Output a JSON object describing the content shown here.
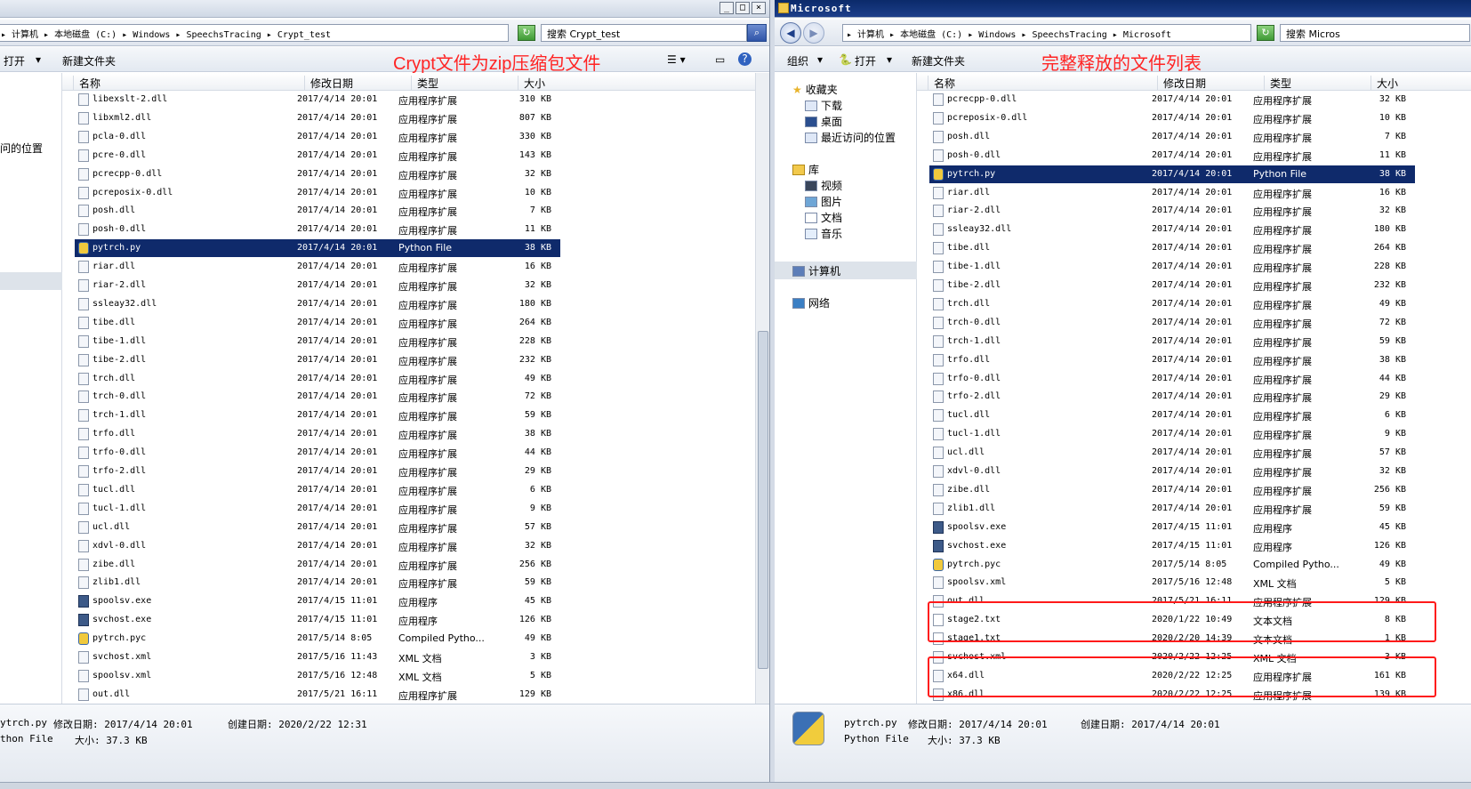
{
  "left": {
    "address": "▸ 计算机 ▸ 本地磁盘 (C:) ▸ Windows ▸ SpeechsTracing ▸ Crypt_test",
    "search_text": "搜索 Crypt_test",
    "toolbar": {
      "open": "打开",
      "new_folder": "新建文件夹"
    },
    "annotation": "Crypt文件为zip压缩包文件",
    "nav_fragment": "问的位置",
    "columns": {
      "name": "名称",
      "date": "修改日期",
      "type": "类型",
      "size": "大小"
    },
    "files": [
      {
        "name": "libexslt-2.dll",
        "date": "2017/4/14 20:01",
        "type": "应用程序扩展",
        "size": "310 KB",
        "icon": "dll"
      },
      {
        "name": "libxml2.dll",
        "date": "2017/4/14 20:01",
        "type": "应用程序扩展",
        "size": "807 KB",
        "icon": "dll"
      },
      {
        "name": "pcla-0.dll",
        "date": "2017/4/14 20:01",
        "type": "应用程序扩展",
        "size": "330 KB",
        "icon": "dll"
      },
      {
        "name": "pcre-0.dll",
        "date": "2017/4/14 20:01",
        "type": "应用程序扩展",
        "size": "143 KB",
        "icon": "dll"
      },
      {
        "name": "pcrecpp-0.dll",
        "date": "2017/4/14 20:01",
        "type": "应用程序扩展",
        "size": "32 KB",
        "icon": "dll"
      },
      {
        "name": "pcreposix-0.dll",
        "date": "2017/4/14 20:01",
        "type": "应用程序扩展",
        "size": "10 KB",
        "icon": "dll"
      },
      {
        "name": "posh.dll",
        "date": "2017/4/14 20:01",
        "type": "应用程序扩展",
        "size": "7 KB",
        "icon": "dll"
      },
      {
        "name": "posh-0.dll",
        "date": "2017/4/14 20:01",
        "type": "应用程序扩展",
        "size": "11 KB",
        "icon": "dll"
      },
      {
        "name": "pytrch.py",
        "date": "2017/4/14 20:01",
        "type": "Python File",
        "size": "38 KB",
        "icon": "py",
        "selected": true
      },
      {
        "name": "riar.dll",
        "date": "2017/4/14 20:01",
        "type": "应用程序扩展",
        "size": "16 KB",
        "icon": "dll"
      },
      {
        "name": "riar-2.dll",
        "date": "2017/4/14 20:01",
        "type": "应用程序扩展",
        "size": "32 KB",
        "icon": "dll"
      },
      {
        "name": "ssleay32.dll",
        "date": "2017/4/14 20:01",
        "type": "应用程序扩展",
        "size": "180 KB",
        "icon": "dll"
      },
      {
        "name": "tibe.dll",
        "date": "2017/4/14 20:01",
        "type": "应用程序扩展",
        "size": "264 KB",
        "icon": "dll"
      },
      {
        "name": "tibe-1.dll",
        "date": "2017/4/14 20:01",
        "type": "应用程序扩展",
        "size": "228 KB",
        "icon": "dll"
      },
      {
        "name": "tibe-2.dll",
        "date": "2017/4/14 20:01",
        "type": "应用程序扩展",
        "size": "232 KB",
        "icon": "dll"
      },
      {
        "name": "trch.dll",
        "date": "2017/4/14 20:01",
        "type": "应用程序扩展",
        "size": "49 KB",
        "icon": "dll"
      },
      {
        "name": "trch-0.dll",
        "date": "2017/4/14 20:01",
        "type": "应用程序扩展",
        "size": "72 KB",
        "icon": "dll"
      },
      {
        "name": "trch-1.dll",
        "date": "2017/4/14 20:01",
        "type": "应用程序扩展",
        "size": "59 KB",
        "icon": "dll"
      },
      {
        "name": "trfo.dll",
        "date": "2017/4/14 20:01",
        "type": "应用程序扩展",
        "size": "38 KB",
        "icon": "dll"
      },
      {
        "name": "trfo-0.dll",
        "date": "2017/4/14 20:01",
        "type": "应用程序扩展",
        "size": "44 KB",
        "icon": "dll"
      },
      {
        "name": "trfo-2.dll",
        "date": "2017/4/14 20:01",
        "type": "应用程序扩展",
        "size": "29 KB",
        "icon": "dll"
      },
      {
        "name": "tucl.dll",
        "date": "2017/4/14 20:01",
        "type": "应用程序扩展",
        "size": "6 KB",
        "icon": "dll"
      },
      {
        "name": "tucl-1.dll",
        "date": "2017/4/14 20:01",
        "type": "应用程序扩展",
        "size": "9 KB",
        "icon": "dll"
      },
      {
        "name": "ucl.dll",
        "date": "2017/4/14 20:01",
        "type": "应用程序扩展",
        "size": "57 KB",
        "icon": "dll"
      },
      {
        "name": "xdvl-0.dll",
        "date": "2017/4/14 20:01",
        "type": "应用程序扩展",
        "size": "32 KB",
        "icon": "dll"
      },
      {
        "name": "zibe.dll",
        "date": "2017/4/14 20:01",
        "type": "应用程序扩展",
        "size": "256 KB",
        "icon": "dll"
      },
      {
        "name": "zlib1.dll",
        "date": "2017/4/14 20:01",
        "type": "应用程序扩展",
        "size": "59 KB",
        "icon": "dll"
      },
      {
        "name": "spoolsv.exe",
        "date": "2017/4/15 11:01",
        "type": "应用程序",
        "size": "45 KB",
        "icon": "exe"
      },
      {
        "name": "svchost.exe",
        "date": "2017/4/15 11:01",
        "type": "应用程序",
        "size": "126 KB",
        "icon": "exe"
      },
      {
        "name": "pytrch.pyc",
        "date": "2017/5/14 8:05",
        "type": "Compiled Pytho...",
        "size": "49 KB",
        "icon": "py"
      },
      {
        "name": "svchost.xml",
        "date": "2017/5/16 11:43",
        "type": "XML 文档",
        "size": "3 KB",
        "icon": "dll"
      },
      {
        "name": "spoolsv.xml",
        "date": "2017/5/16 12:48",
        "type": "XML 文档",
        "size": "5 KB",
        "icon": "dll"
      },
      {
        "name": "out.dll",
        "date": "2017/5/21 16:11",
        "type": "应用程序扩展",
        "size": "129 KB",
        "icon": "dll"
      }
    ],
    "details": {
      "name": "ytrch.py",
      "modified": "修改日期: 2017/4/14 20:01",
      "created": "创建日期: 2020/2/22 12:31",
      "type": "thon File",
      "size": "大小: 37.3 KB"
    }
  },
  "right": {
    "title": "Microsoft",
    "address": "▸ 计算机 ▸ 本地磁盘 (C:) ▸ Windows ▸ SpeechsTracing ▸ Microsoft",
    "search_text": "搜索 Micros",
    "toolbar": {
      "organize": "组织",
      "open": "打开",
      "new_folder": "新建文件夹"
    },
    "annotation": "完整释放的文件列表",
    "nav": {
      "favorites": "收藏夹",
      "downloads": "下载",
      "desktop": "桌面",
      "recent": "最近访问的位置",
      "library": "库",
      "video": "视频",
      "pictures": "图片",
      "documents": "文档",
      "music": "音乐",
      "computer": "计算机",
      "network": "网络"
    },
    "columns": {
      "name": "名称",
      "date": "修改日期",
      "type": "类型",
      "size": "大小"
    },
    "files": [
      {
        "name": "pcrecpp-0.dll",
        "date": "2017/4/14 20:01",
        "type": "应用程序扩展",
        "size": "32 KB",
        "icon": "dll"
      },
      {
        "name": "pcreposix-0.dll",
        "date": "2017/4/14 20:01",
        "type": "应用程序扩展",
        "size": "10 KB",
        "icon": "dll"
      },
      {
        "name": "posh.dll",
        "date": "2017/4/14 20:01",
        "type": "应用程序扩展",
        "size": "7 KB",
        "icon": "dll"
      },
      {
        "name": "posh-0.dll",
        "date": "2017/4/14 20:01",
        "type": "应用程序扩展",
        "size": "11 KB",
        "icon": "dll"
      },
      {
        "name": "pytrch.py",
        "date": "2017/4/14 20:01",
        "type": "Python File",
        "size": "38 KB",
        "icon": "py",
        "selected": true
      },
      {
        "name": "riar.dll",
        "date": "2017/4/14 20:01",
        "type": "应用程序扩展",
        "size": "16 KB",
        "icon": "dll"
      },
      {
        "name": "riar-2.dll",
        "date": "2017/4/14 20:01",
        "type": "应用程序扩展",
        "size": "32 KB",
        "icon": "dll"
      },
      {
        "name": "ssleay32.dll",
        "date": "2017/4/14 20:01",
        "type": "应用程序扩展",
        "size": "180 KB",
        "icon": "dll"
      },
      {
        "name": "tibe.dll",
        "date": "2017/4/14 20:01",
        "type": "应用程序扩展",
        "size": "264 KB",
        "icon": "dll"
      },
      {
        "name": "tibe-1.dll",
        "date": "2017/4/14 20:01",
        "type": "应用程序扩展",
        "size": "228 KB",
        "icon": "dll"
      },
      {
        "name": "tibe-2.dll",
        "date": "2017/4/14 20:01",
        "type": "应用程序扩展",
        "size": "232 KB",
        "icon": "dll"
      },
      {
        "name": "trch.dll",
        "date": "2017/4/14 20:01",
        "type": "应用程序扩展",
        "size": "49 KB",
        "icon": "dll"
      },
      {
        "name": "trch-0.dll",
        "date": "2017/4/14 20:01",
        "type": "应用程序扩展",
        "size": "72 KB",
        "icon": "dll"
      },
      {
        "name": "trch-1.dll",
        "date": "2017/4/14 20:01",
        "type": "应用程序扩展",
        "size": "59 KB",
        "icon": "dll"
      },
      {
        "name": "trfo.dll",
        "date": "2017/4/14 20:01",
        "type": "应用程序扩展",
        "size": "38 KB",
        "icon": "dll"
      },
      {
        "name": "trfo-0.dll",
        "date": "2017/4/14 20:01",
        "type": "应用程序扩展",
        "size": "44 KB",
        "icon": "dll"
      },
      {
        "name": "trfo-2.dll",
        "date": "2017/4/14 20:01",
        "type": "应用程序扩展",
        "size": "29 KB",
        "icon": "dll"
      },
      {
        "name": "tucl.dll",
        "date": "2017/4/14 20:01",
        "type": "应用程序扩展",
        "size": "6 KB",
        "icon": "dll"
      },
      {
        "name": "tucl-1.dll",
        "date": "2017/4/14 20:01",
        "type": "应用程序扩展",
        "size": "9 KB",
        "icon": "dll"
      },
      {
        "name": "ucl.dll",
        "date": "2017/4/14 20:01",
        "type": "应用程序扩展",
        "size": "57 KB",
        "icon": "dll"
      },
      {
        "name": "xdvl-0.dll",
        "date": "2017/4/14 20:01",
        "type": "应用程序扩展",
        "size": "32 KB",
        "icon": "dll"
      },
      {
        "name": "zibe.dll",
        "date": "2017/4/14 20:01",
        "type": "应用程序扩展",
        "size": "256 KB",
        "icon": "dll"
      },
      {
        "name": "zlib1.dll",
        "date": "2017/4/14 20:01",
        "type": "应用程序扩展",
        "size": "59 KB",
        "icon": "dll"
      },
      {
        "name": "spoolsv.exe",
        "date": "2017/4/15 11:01",
        "type": "应用程序",
        "size": "45 KB",
        "icon": "exe"
      },
      {
        "name": "svchost.exe",
        "date": "2017/4/15 11:01",
        "type": "应用程序",
        "size": "126 KB",
        "icon": "exe"
      },
      {
        "name": "pytrch.pyc",
        "date": "2017/5/14 8:05",
        "type": "Compiled Pytho...",
        "size": "49 KB",
        "icon": "py"
      },
      {
        "name": "spoolsv.xml",
        "date": "2017/5/16 12:48",
        "type": "XML 文档",
        "size": "5 KB",
        "icon": "dll"
      },
      {
        "name": "out.dll",
        "date": "2017/5/21 16:11",
        "type": "应用程序扩展",
        "size": "129 KB",
        "icon": "dll"
      },
      {
        "name": "stage2.txt",
        "date": "2020/1/22 10:49",
        "type": "文本文档",
        "size": "8 KB",
        "icon": "txt"
      },
      {
        "name": "stage1.txt",
        "date": "2020/2/20 14:39",
        "type": "文本文档",
        "size": "1 KB",
        "icon": "txt"
      },
      {
        "name": "svchost.xml",
        "date": "2020/2/22 12:25",
        "type": "XML 文档",
        "size": "3 KB",
        "icon": "dll"
      },
      {
        "name": "x64.dll",
        "date": "2020/2/22 12:25",
        "type": "应用程序扩展",
        "size": "161 KB",
        "icon": "dll"
      },
      {
        "name": "x86.dll",
        "date": "2020/2/22 12:25",
        "type": "应用程序扩展",
        "size": "139 KB",
        "icon": "dll"
      }
    ],
    "details": {
      "name": "pytrch.py",
      "modified": "修改日期: 2017/4/14 20:01",
      "created": "创建日期: 2017/4/14 20:01",
      "type": "Python File",
      "size": "大小: 37.3 KB"
    }
  },
  "colors": {
    "selection": "#0f2a6b",
    "annotation": "#ff2424"
  }
}
